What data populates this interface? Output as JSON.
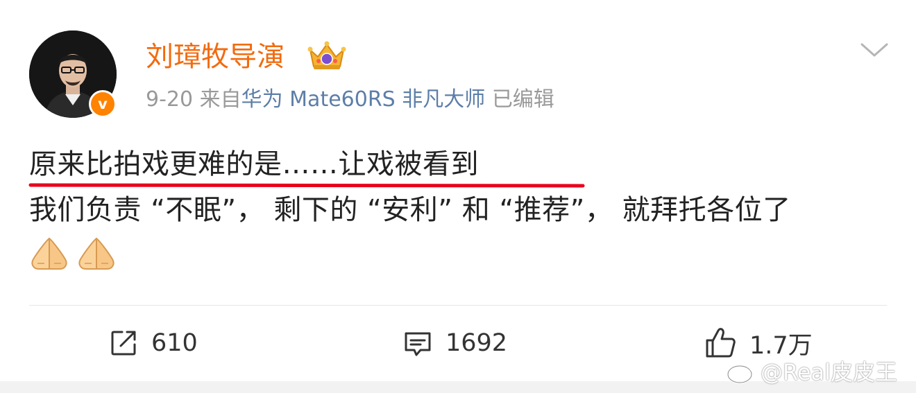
{
  "post": {
    "author": {
      "name": "刘璋牧导演",
      "verified_badge_text": "v",
      "vip_icon": "vip-crown-icon"
    },
    "meta": {
      "date": "9-20",
      "source_prefix": "来自",
      "source": "华为 Mate60RS 非凡大师",
      "edited": "已编辑"
    },
    "content": {
      "line1": "原来比拍戏更难的是……让戏被看到",
      "line2": "我们负责 “不眠”， 剩下的 “安利” 和 “推荐”， 就拜托各位了",
      "emojis": [
        "folded-hands-emoji",
        "folded-hands-emoji"
      ]
    },
    "actions": {
      "repost": {
        "icon": "repost-icon",
        "count": "610"
      },
      "comment": {
        "icon": "comment-icon",
        "count": "1692"
      },
      "like": {
        "icon": "thumbs-up-icon",
        "count": "1.7万"
      }
    },
    "menu_icon": "chevron-down-icon"
  },
  "watermark": {
    "icon": "weibo-logo-icon",
    "text": "@Real皮皮王"
  },
  "colors": {
    "username": "#f26b0f",
    "verified": "#ff8200",
    "source_link": "#5d7ea8",
    "meta_gray": "#999999",
    "underline_annotation": "#e8001c",
    "text": "#222222"
  }
}
